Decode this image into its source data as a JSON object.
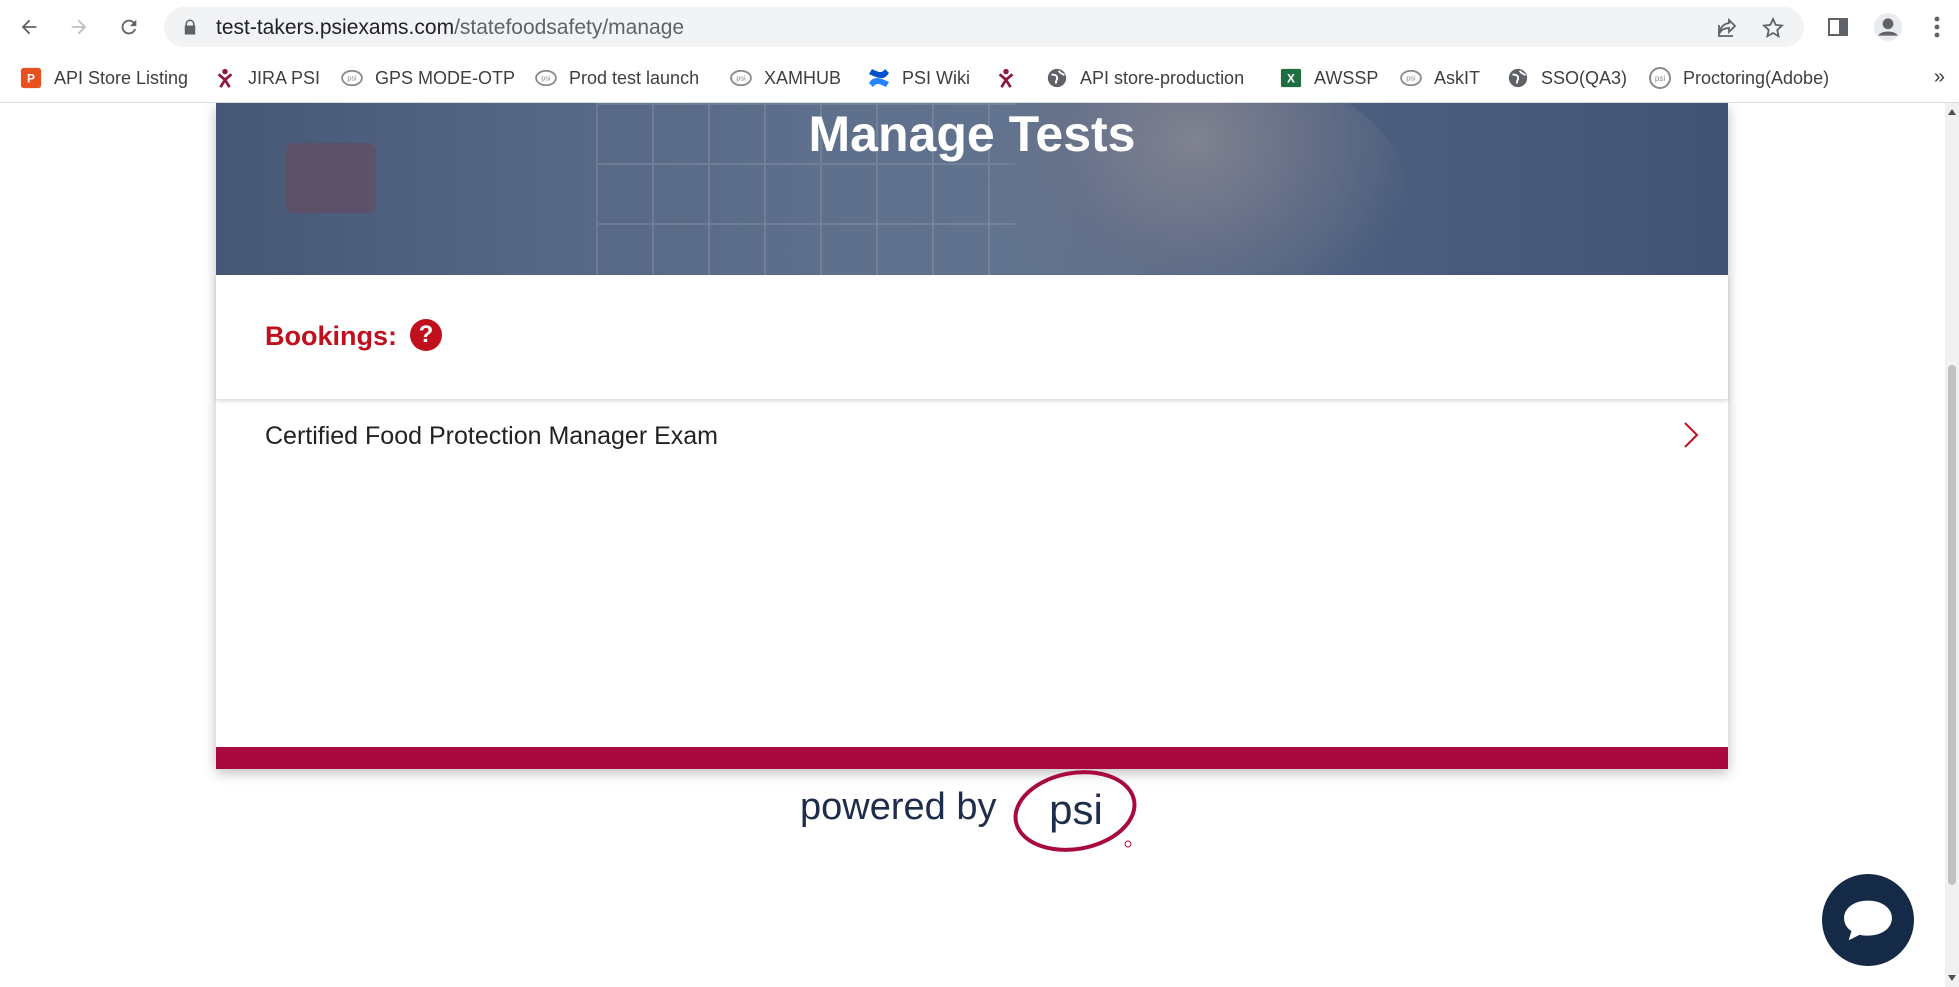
{
  "browser": {
    "url_host": "test-takers.psiexams.com",
    "url_path": "/statefoodsafety/manage",
    "nav": {
      "back": "back-arrow-icon",
      "forward": "forward-arrow-icon",
      "reload": "reload-icon"
    },
    "bookmarks": [
      {
        "label": "API Store Listing",
        "icon": "api-store-icon",
        "color": "#e8501f"
      },
      {
        "label": "JIRA PSI",
        "icon": "jira-icon",
        "color": "#8b1a3b"
      },
      {
        "label": "GPS MODE-OTP",
        "icon": "psi-icon",
        "color": "#8a8a8a"
      },
      {
        "label": "Prod test launch",
        "icon": "psi-icon",
        "color": "#8a8a8a"
      },
      {
        "label": "XAMHUB",
        "icon": "psi-icon",
        "color": "#8a8a8a"
      },
      {
        "label": "PSI Wiki",
        "icon": "confluence-icon",
        "color": "#2684ff"
      },
      {
        "label": "",
        "icon": "jira-icon",
        "color": "#8b1a3b"
      },
      {
        "label": "API store-production",
        "icon": "globe-icon",
        "color": "#5f6368"
      },
      {
        "label": "AWSSP",
        "icon": "excel-icon",
        "color": "#1d6f42"
      },
      {
        "label": "AskIT",
        "icon": "psi-icon",
        "color": "#8a8a8a"
      },
      {
        "label": "SSO(QA3)",
        "icon": "globe-icon",
        "color": "#5f6368"
      },
      {
        "label": "Proctoring(Adobe)",
        "icon": "psi-icon",
        "color": "#8a8a8a"
      }
    ],
    "more_bookmarks": "»"
  },
  "page": {
    "hero_title": "Manage Tests",
    "bookings_label": "Bookings:",
    "help_symbol": "?",
    "exams": [
      {
        "name": "Certified Food Protection Manager Exam"
      }
    ],
    "powered_by": "powered by",
    "brand": "psi",
    "colors": {
      "accent_red": "#c0101e",
      "footer_bar": "#a8093f",
      "brand_navy": "#1f2d4d",
      "chat_bg": "#152a47"
    }
  }
}
